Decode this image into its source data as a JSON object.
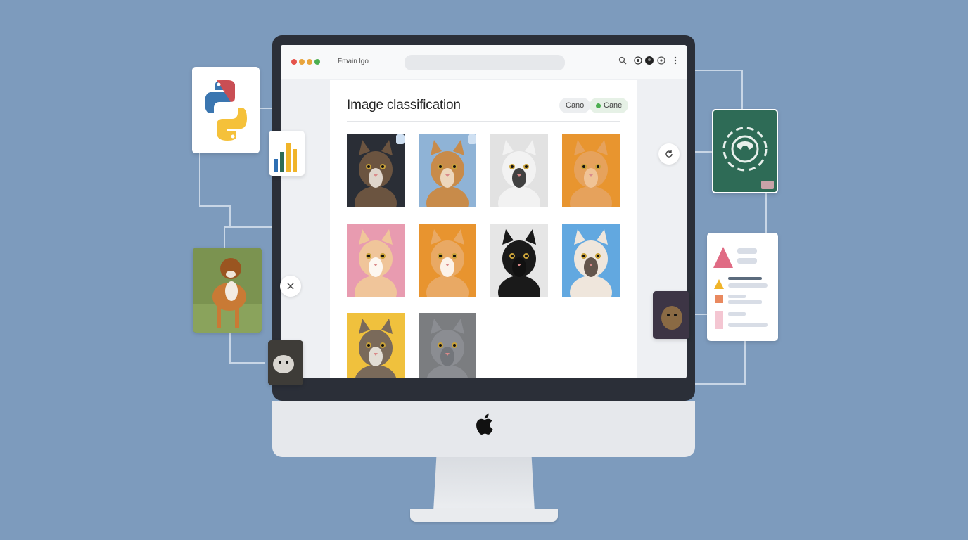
{
  "window": {
    "title": "Fmain lgo"
  },
  "page": {
    "title": "Image classification",
    "button_1": "Cano",
    "button_2": "Cane",
    "button_2_icon": "check-circle-icon"
  },
  "toolbar": {
    "icons": [
      "search-icon",
      "profile-icon",
      "avatar-icon",
      "settings-icon",
      "more-icon"
    ]
  },
  "grid": {
    "images": [
      {
        "label": "tabby-cat",
        "bg": "#2a2e36"
      },
      {
        "label": "orange-tabby-cat",
        "bg": "#8fb3d6"
      },
      {
        "label": "black-white-cat",
        "bg": "#e2e2e2"
      },
      {
        "label": "orange-cat",
        "bg": "#e8952f"
      },
      {
        "label": "orange-white-cat",
        "bg": "#e89bb0"
      },
      {
        "label": "ginger-white-cat",
        "bg": "#e8942f"
      },
      {
        "label": "black-cat",
        "bg": "#e6e6e6"
      },
      {
        "label": "siamese-cat",
        "bg": "#62a8e0"
      },
      {
        "label": "calico-cat",
        "bg": "#f0c13d"
      },
      {
        "label": "gray-cat",
        "bg": "#7b7d80"
      }
    ]
  },
  "side": {
    "left": [
      "python-logo-icon",
      "bar-chart-icon",
      "dog-photo",
      "close-icon",
      "animal-photo"
    ],
    "right": [
      "brain-network-icon",
      "refresh-icon",
      "report-card",
      "animal-photo"
    ]
  },
  "colors": {
    "background": "#7d9bbd",
    "accent_green": "#2e6b56",
    "report_pink": "#e06b84"
  }
}
